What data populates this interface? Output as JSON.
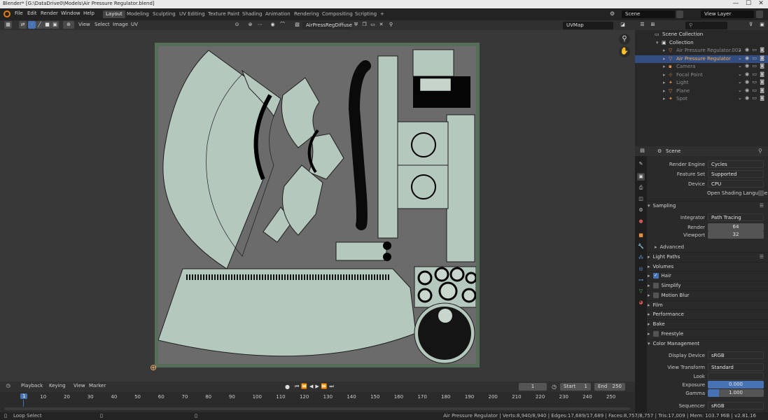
{
  "window": {
    "title": "Blender* [G:\\DataDrive0\\Models\\Air Pressure Regulator.blend]",
    "min": "—",
    "max": "☐",
    "close": "✕"
  },
  "menu": [
    "File",
    "Edit",
    "Render",
    "Window",
    "Help"
  ],
  "workspaces": [
    "Layout",
    "Modeling",
    "Sculpting",
    "UV Editing",
    "Texture Paint",
    "Shading",
    "Animation",
    "Rendering",
    "Compositing",
    "Scripting"
  ],
  "workspace_add": "+",
  "scene_field": "Scene",
  "view_layer_field": "View Layer",
  "uv_editor": {
    "menus": [
      "View",
      "Select",
      "Image",
      "UV"
    ],
    "image_name": "AirPressRegDiffuse",
    "uvmap": "UVMap"
  },
  "outliner": {
    "search_placeholder": "",
    "rows": [
      {
        "label": "Scene Collection",
        "depth": 0,
        "type": "scene-collection",
        "color": "#dddddd",
        "selected": false
      },
      {
        "label": "Collection",
        "depth": 1,
        "type": "collection",
        "color": "#dddddd",
        "selected": false
      },
      {
        "label": "Air Pressure Regulator.002",
        "depth": 2,
        "type": "mesh",
        "color": "#8c8c8c",
        "selected": false
      },
      {
        "label": "Air Pressure Regulator",
        "depth": 2,
        "type": "mesh",
        "color": "#f0b050",
        "selected": true
      },
      {
        "label": "Camera",
        "depth": 2,
        "type": "camera",
        "color": "#8c8c8c",
        "selected": false
      },
      {
        "label": "Focal Point",
        "depth": 2,
        "type": "empty",
        "color": "#8c8c8c",
        "selected": false
      },
      {
        "label": "Light",
        "depth": 2,
        "type": "light",
        "color": "#8c8c8c",
        "selected": false
      },
      {
        "label": "Plane",
        "depth": 2,
        "type": "mesh",
        "color": "#8c8c8c",
        "selected": false
      },
      {
        "label": "Spot",
        "depth": 2,
        "type": "light",
        "color": "#8c8c8c",
        "selected": false
      }
    ]
  },
  "properties": {
    "context": "Scene",
    "render_engine": {
      "label": "Render Engine",
      "value": "Cycles"
    },
    "feature_set": {
      "label": "Feature Set",
      "value": "Supported"
    },
    "device": {
      "label": "Device",
      "value": "CPU"
    },
    "osl": {
      "label": "Open Shading Language",
      "checked": false
    },
    "sampling": {
      "title": "Sampling",
      "integrator_label": "Integrator",
      "integrator": "Path Tracing",
      "render_label": "Render",
      "render": "64",
      "viewport_label": "Viewport",
      "viewport": "32",
      "advanced": "Advanced"
    },
    "sections": [
      {
        "label": "Light Paths",
        "checkbox": null
      },
      {
        "label": "Volumes",
        "checkbox": null
      },
      {
        "label": "Hair",
        "checkbox": true
      },
      {
        "label": "Simplify",
        "checkbox": false
      },
      {
        "label": "Motion Blur",
        "checkbox": false
      },
      {
        "label": "Film",
        "checkbox": null
      },
      {
        "label": "Performance",
        "checkbox": null
      },
      {
        "label": "Bake",
        "checkbox": null
      },
      {
        "label": "Freestyle",
        "checkbox": false
      }
    ],
    "color_management": {
      "title": "Color Management",
      "display_device_label": "Display Device",
      "display_device": "sRGB",
      "view_transform_label": "View Transform",
      "view_transform": "Standard",
      "look_label": "Look",
      "look": "",
      "exposure_label": "Exposure",
      "exposure": "0.000",
      "gamma_label": "Gamma",
      "gamma": "1.000",
      "sequencer_label": "Sequencer",
      "sequencer": "sRGB"
    }
  },
  "timeline": {
    "menus": [
      "Playback",
      "Keying",
      "View",
      "Marker"
    ],
    "current_frame": "1",
    "start_label": "Start",
    "start": "1",
    "end_label": "End",
    "end": "250",
    "ticks": [
      "1",
      "10",
      "20",
      "30",
      "40",
      "50",
      "60",
      "70",
      "80",
      "90",
      "100",
      "110",
      "120",
      "130",
      "140",
      "150",
      "160",
      "170",
      "180",
      "190",
      "200",
      "210",
      "220",
      "230",
      "240",
      "250"
    ]
  },
  "status": {
    "left": "Loop Select",
    "right": "Air Pressure Regulator | Verts:8,940/8,940 | Edges:17,689/17,689 | Faces:8,757/8,757 | Tris:17,009 | Mem: 103.7 MiB | v2.81.16"
  }
}
